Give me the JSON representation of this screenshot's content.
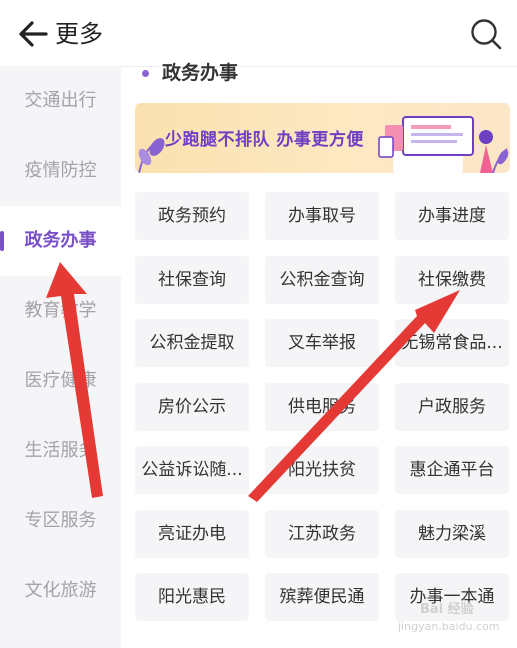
{
  "header": {
    "title": "更多",
    "back_icon": "arrow-left-icon",
    "search_icon": "search-icon"
  },
  "sidebar": {
    "items": [
      {
        "label": "交通出行",
        "active": false
      },
      {
        "label": "疫情防控",
        "active": false
      },
      {
        "label": "政务办事",
        "active": true
      },
      {
        "label": "教育教学",
        "active": false
      },
      {
        "label": "医疗健康",
        "active": false
      },
      {
        "label": "生活服务",
        "active": false
      },
      {
        "label": "专区服务",
        "active": false
      },
      {
        "label": "文化旅游",
        "active": false
      }
    ]
  },
  "section": {
    "title": "政务办事"
  },
  "banner": {
    "text": "少跑腿不排队  办事更方便"
  },
  "services": [
    "政务预约",
    "办事取号",
    "办事进度",
    "社保查询",
    "公积金查询",
    "社保缴费",
    "公积金提取",
    "叉车举报",
    "无锡常食品...",
    "房价公示",
    "供电服务",
    "户政服务",
    "公益诉讼随...",
    "阳光扶贫",
    "惠企通平台",
    "亮证办电",
    "江苏政务",
    "魅力梁溪",
    "阳光惠民",
    "殡葬便民通",
    "办事一本通"
  ],
  "watermark": {
    "main": "Bai 经验",
    "sub": "jingyan.baidu.com"
  },
  "colors": {
    "accent": "#7a50c8",
    "annotation_arrow": "#e53935",
    "tile_bg": "#f5f5f7"
  }
}
